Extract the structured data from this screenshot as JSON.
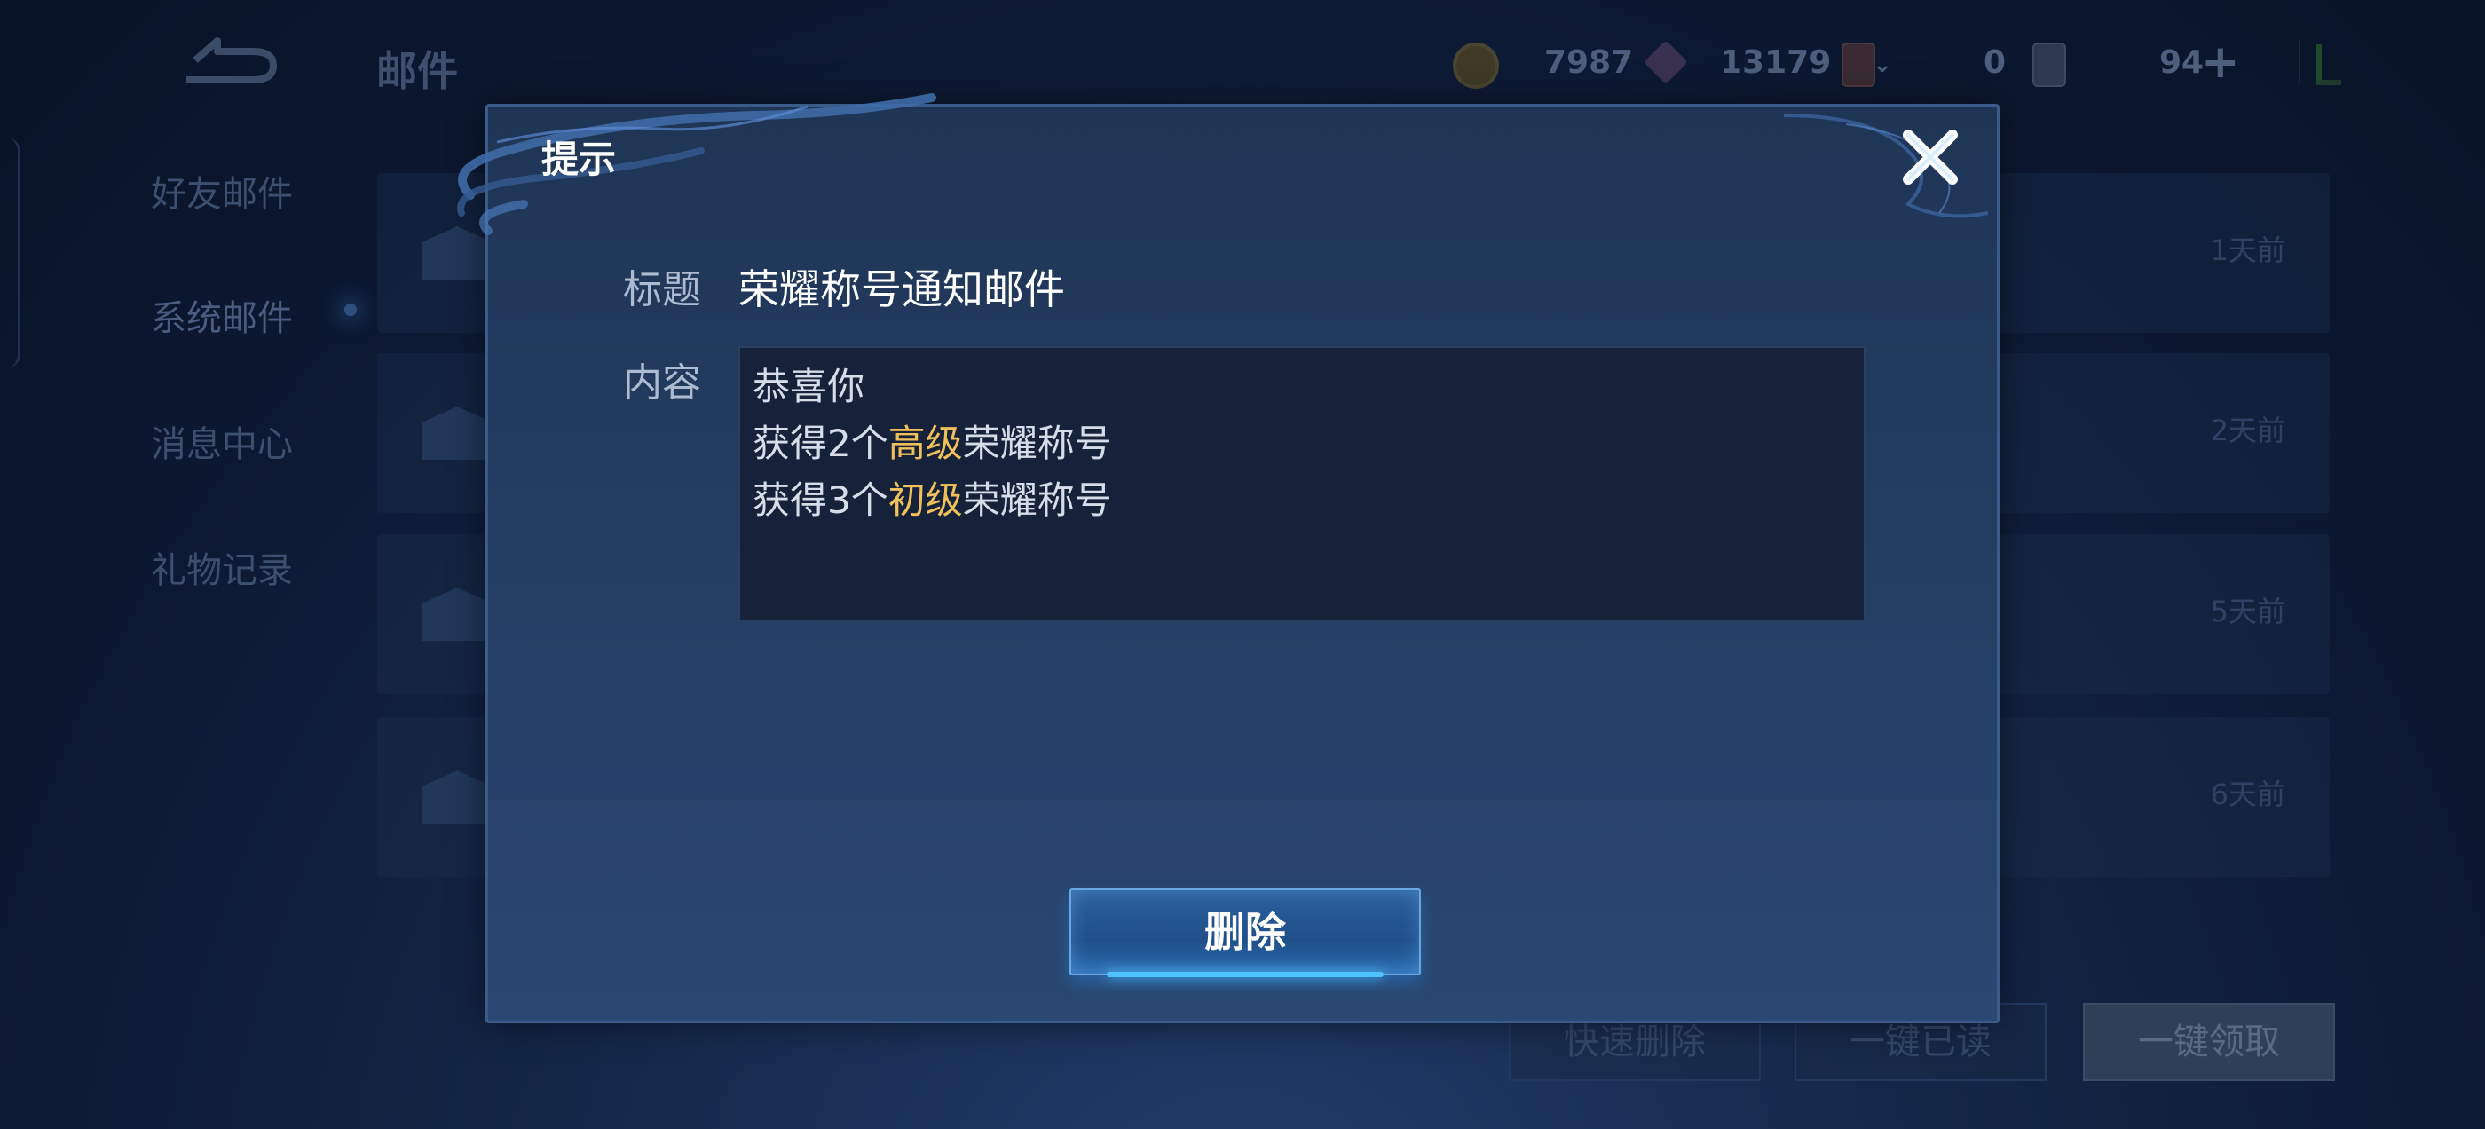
{
  "header": {
    "title": "邮件",
    "currencies": [
      {
        "icon": "gold-coin-icon",
        "value": "7987"
      },
      {
        "icon": "diamond-icon",
        "value": "13179"
      },
      {
        "icon": "card-icon",
        "value": ""
      },
      {
        "icon": "ticket-icon",
        "value": "0"
      }
    ],
    "energy": "94",
    "add_symbol": "+"
  },
  "sidebar": {
    "items": [
      {
        "label": "好友邮件"
      },
      {
        "label": "系统邮件"
      },
      {
        "label": "消息中心"
      },
      {
        "label": "礼物记录"
      }
    ]
  },
  "mail_list": {
    "rows": [
      {
        "time": "1天前"
      },
      {
        "time": "2天前"
      },
      {
        "time": "5天前"
      },
      {
        "time": "6天前"
      }
    ]
  },
  "footer": {
    "quick_delete": "快速删除",
    "mark_all_read": "一键已读",
    "claim_all": "一键领取"
  },
  "modal": {
    "title": "提示",
    "subject_label": "标题",
    "subject": "荣耀称号通知邮件",
    "content_label": "内容",
    "content": {
      "line1": "恭喜你",
      "line2_pre": "获得2个",
      "line2_hl": "高级",
      "line2_post": "荣耀称号",
      "line3_pre": "获得3个",
      "line3_hl": "初级",
      "line3_post": "荣耀称号"
    },
    "delete_label": "删除",
    "highlight_color": "#f0c15b",
    "button_color": "#2b5f9c"
  }
}
